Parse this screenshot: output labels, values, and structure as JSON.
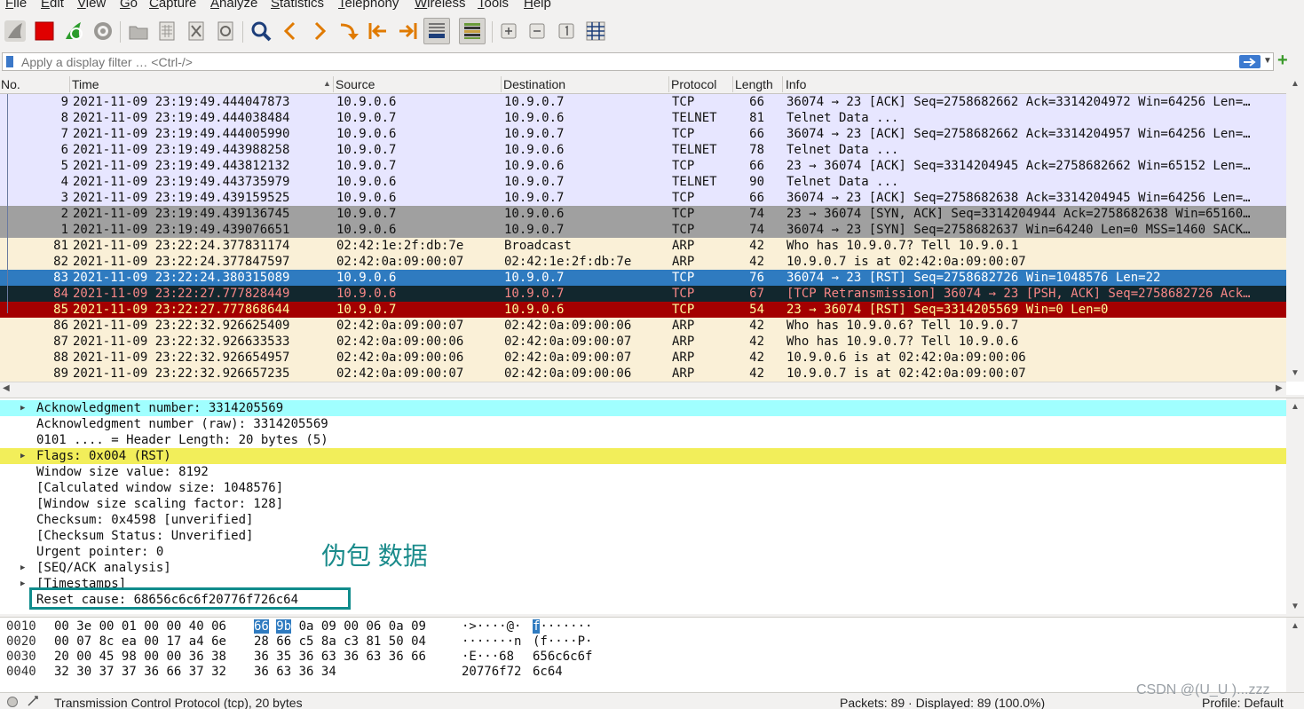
{
  "menu": [
    "File",
    "Edit",
    "View",
    "Go",
    "Capture",
    "Analyze",
    "Statistics",
    "Telephony",
    "Wireless",
    "Tools",
    "Help"
  ],
  "filter": {
    "placeholder": "Apply a display filter … <Ctrl-/>"
  },
  "columns": [
    "No.",
    "Time",
    "Source",
    "Destination",
    "Protocol",
    "Length",
    "Info"
  ],
  "packets": [
    {
      "no": "9",
      "time": "2021-11-09 23:19:49.444047873",
      "src": "10.9.0.6",
      "dst": "10.9.0.7",
      "proto": "TCP",
      "len": "66",
      "info": "36074 → 23 [ACK] Seq=2758682662 Ack=3314204972 Win=64256 Len=…",
      "color": "tcp"
    },
    {
      "no": "8",
      "time": "2021-11-09 23:19:49.444038484",
      "src": "10.9.0.7",
      "dst": "10.9.0.6",
      "proto": "TELNET",
      "len": "81",
      "info": "Telnet Data ...",
      "color": "tcp"
    },
    {
      "no": "7",
      "time": "2021-11-09 23:19:49.444005990",
      "src": "10.9.0.6",
      "dst": "10.9.0.7",
      "proto": "TCP",
      "len": "66",
      "info": "36074 → 23 [ACK] Seq=2758682662 Ack=3314204957 Win=64256 Len=…",
      "color": "tcp"
    },
    {
      "no": "6",
      "time": "2021-11-09 23:19:49.443988258",
      "src": "10.9.0.7",
      "dst": "10.9.0.6",
      "proto": "TELNET",
      "len": "78",
      "info": "Telnet Data ...",
      "color": "tcp"
    },
    {
      "no": "5",
      "time": "2021-11-09 23:19:49.443812132",
      "src": "10.9.0.7",
      "dst": "10.9.0.6",
      "proto": "TCP",
      "len": "66",
      "info": "23 → 36074 [ACK] Seq=3314204945 Ack=2758682662 Win=65152 Len=…",
      "color": "tcp"
    },
    {
      "no": "4",
      "time": "2021-11-09 23:19:49.443735979",
      "src": "10.9.0.6",
      "dst": "10.9.0.7",
      "proto": "TELNET",
      "len": "90",
      "info": "Telnet Data ...",
      "color": "tcp"
    },
    {
      "no": "3",
      "time": "2021-11-09 23:19:49.439159525",
      "src": "10.9.0.6",
      "dst": "10.9.0.7",
      "proto": "TCP",
      "len": "66",
      "info": "36074 → 23 [ACK] Seq=2758682638 Ack=3314204945 Win=64256 Len=…",
      "color": "tcp"
    },
    {
      "no": "2",
      "time": "2021-11-09 23:19:49.439136745",
      "src": "10.9.0.7",
      "dst": "10.9.0.6",
      "proto": "TCP",
      "len": "74",
      "info": "23 → 36074 [SYN, ACK] Seq=3314204944 Ack=2758682638 Win=65160…",
      "color": "syn"
    },
    {
      "no": "1",
      "time": "2021-11-09 23:19:49.439076651",
      "src": "10.9.0.6",
      "dst": "10.9.0.7",
      "proto": "TCP",
      "len": "74",
      "info": "36074 → 23 [SYN] Seq=2758682637 Win=64240 Len=0 MSS=1460 SACK…",
      "color": "syn"
    },
    {
      "no": "81",
      "time": "2021-11-09 23:22:24.377831174",
      "src": "02:42:1e:2f:db:7e",
      "dst": "Broadcast",
      "proto": "ARP",
      "len": "42",
      "info": "Who has 10.9.0.7? Tell 10.9.0.1",
      "color": "arp"
    },
    {
      "no": "82",
      "time": "2021-11-09 23:22:24.377847597",
      "src": "02:42:0a:09:00:07",
      "dst": "02:42:1e:2f:db:7e",
      "proto": "ARP",
      "len": "42",
      "info": "10.9.0.7 is at 02:42:0a:09:00:07",
      "color": "arp"
    },
    {
      "no": "83",
      "time": "2021-11-09 23:22:24.380315089",
      "src": "10.9.0.6",
      "dst": "10.9.0.7",
      "proto": "TCP",
      "len": "76",
      "info": "36074 → 23 [RST] Seq=2758682726 Win=1048576 Len=22",
      "color": "sel"
    },
    {
      "no": "84",
      "time": "2021-11-09 23:22:27.777828449",
      "src": "10.9.0.6",
      "dst": "10.9.0.7",
      "proto": "TCP",
      "len": "67",
      "info": "[TCP Retransmission] 36074 → 23 [PSH, ACK] Seq=2758682726 Ack…",
      "color": "retx"
    },
    {
      "no": "85",
      "time": "2021-11-09 23:22:27.777868644",
      "src": "10.9.0.7",
      "dst": "10.9.0.6",
      "proto": "TCP",
      "len": "54",
      "info": "23 → 36074 [RST] Seq=3314205569 Win=0 Len=0",
      "color": "rst"
    },
    {
      "no": "86",
      "time": "2021-11-09 23:22:32.926625409",
      "src": "02:42:0a:09:00:07",
      "dst": "02:42:0a:09:00:06",
      "proto": "ARP",
      "len": "42",
      "info": "Who has 10.9.0.6? Tell 10.9.0.7",
      "color": "arp"
    },
    {
      "no": "87",
      "time": "2021-11-09 23:22:32.926633533",
      "src": "02:42:0a:09:00:06",
      "dst": "02:42:0a:09:00:07",
      "proto": "ARP",
      "len": "42",
      "info": "Who has 10.9.0.7? Tell 10.9.0.6",
      "color": "arp"
    },
    {
      "no": "88",
      "time": "2021-11-09 23:22:32.926654957",
      "src": "02:42:0a:09:00:06",
      "dst": "02:42:0a:09:00:07",
      "proto": "ARP",
      "len": "42",
      "info": "10.9.0.6 is at 02:42:0a:09:00:06",
      "color": "arp"
    },
    {
      "no": "89",
      "time": "2021-11-09 23:22:32.926657235",
      "src": "02:42:0a:09:00:07",
      "dst": "02:42:0a:09:00:06",
      "proto": "ARP",
      "len": "42",
      "info": "10.9.0.7 is at 02:42:0a:09:00:07",
      "color": "arp"
    }
  ],
  "details": [
    {
      "text": "Acknowledgment number: 3314205569",
      "expand": true,
      "hl": "cyan"
    },
    {
      "text": "Acknowledgment number (raw): 3314205569",
      "expand": false,
      "hl": ""
    },
    {
      "text": "0101 .... = Header Length: 20 bytes (5)",
      "expand": false,
      "hl": ""
    },
    {
      "text": "Flags: 0x004 (RST)",
      "expand": true,
      "hl": "yellow"
    },
    {
      "text": "Window size value: 8192",
      "expand": false,
      "hl": ""
    },
    {
      "text": "[Calculated window size: 1048576]",
      "expand": false,
      "hl": ""
    },
    {
      "text": "[Window size scaling factor: 128]",
      "expand": false,
      "hl": ""
    },
    {
      "text": "Checksum: 0x4598 [unverified]",
      "expand": false,
      "hl": ""
    },
    {
      "text": "[Checksum Status: Unverified]",
      "expand": false,
      "hl": ""
    },
    {
      "text": "Urgent pointer: 0",
      "expand": false,
      "hl": ""
    },
    {
      "text": "[SEQ/ACK analysis]",
      "expand": true,
      "hl": ""
    },
    {
      "text": "[Timestamps]",
      "expand": true,
      "hl": ""
    },
    {
      "text": "Reset cause: 68656c6c6f20776f726c64",
      "expand": false,
      "hl": ""
    }
  ],
  "annotation": "伪包 数据",
  "bytes": [
    {
      "offset": "0010",
      "hex1": [
        "00",
        "3e",
        "00",
        "01",
        "00",
        "00",
        "40",
        "06"
      ],
      "hex2": [
        "66",
        "9b",
        "0a",
        "09",
        "00",
        "06",
        "0a",
        "09"
      ],
      "ascii1": "·>····@·",
      "ascii2": "f·······",
      "hl2": [
        0,
        1
      ]
    },
    {
      "offset": "0020",
      "hex1": [
        "00",
        "07",
        "8c",
        "ea",
        "00",
        "17",
        "a4",
        "6e"
      ],
      "hex2": [
        "28",
        "66",
        "c5",
        "8a",
        "c3",
        "81",
        "50",
        "04"
      ],
      "ascii1": "·······n",
      "ascii2": "(f····P·",
      "hl2": []
    },
    {
      "offset": "0030",
      "hex1": [
        "20",
        "00",
        "45",
        "98",
        "00",
        "00",
        "36",
        "38"
      ],
      "hex2": [
        "36",
        "35",
        "36",
        "63",
        "36",
        "63",
        "36",
        "66"
      ],
      "ascii1": " ·E···68",
      "ascii2": "656c6c6f",
      "hl2": []
    },
    {
      "offset": "0040",
      "hex1": [
        "32",
        "30",
        "37",
        "37",
        "36",
        "66",
        "37",
        "32"
      ],
      "hex2": [
        "36",
        "63",
        "36",
        "34"
      ],
      "ascii1": "20776f72",
      "ascii2": "6c64",
      "hl2": []
    }
  ],
  "status": {
    "left": "Transmission Control Protocol (tcp), 20 bytes",
    "middle": "Packets: 89 · Displayed: 89 (100.0%)",
    "right": "Profile: Default"
  },
  "watermark": "CSDN @(U_U )...zzz",
  "colors": {
    "tcp": "#e7e6ff",
    "syn": "#a0a0a0",
    "arp": "#faf0d7",
    "selected": "#2f7bc0",
    "retransmission": "#12272e",
    "rst": "#a40000",
    "annotation": "#108c8c"
  }
}
